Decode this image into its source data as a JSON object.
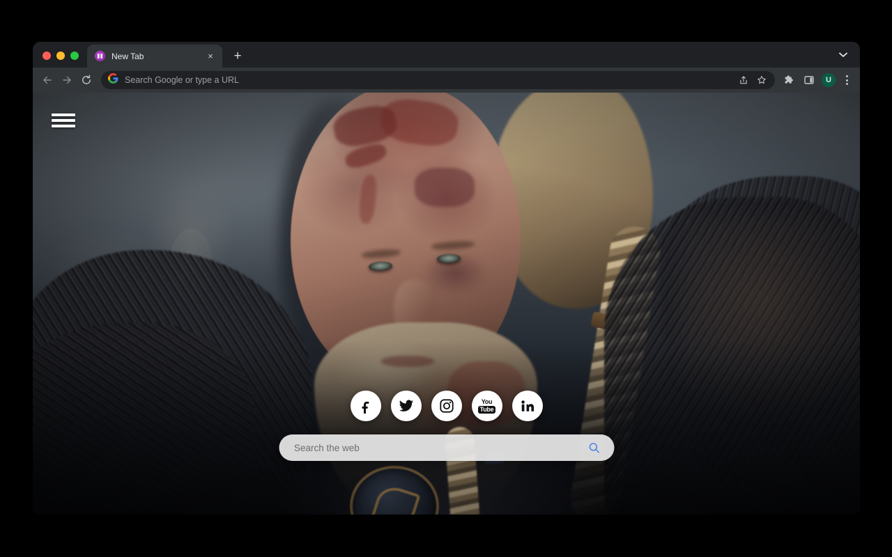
{
  "browser": {
    "window_controls": [
      "close",
      "minimize",
      "maximize"
    ],
    "tab": {
      "title": "New Tab",
      "favicon_name": "wallpaper-extension-favicon",
      "close_label": "×"
    },
    "new_tab_label": "+",
    "tabstrip_chevron_label": "⌄",
    "nav": {
      "back_label": "←",
      "forward_label": "→",
      "reload_label": "⟳"
    },
    "omnibox": {
      "placeholder": "Search Google or type a URL",
      "value": "",
      "site_icon_name": "google-g-icon"
    },
    "toolbar_icons": [
      {
        "name": "share-icon",
        "label": "Share"
      },
      {
        "name": "bookmark-star-icon",
        "label": "Bookmark"
      },
      {
        "name": "extensions-puzzle-icon",
        "label": "Extensions"
      },
      {
        "name": "side-panel-icon",
        "label": "Side panel"
      }
    ],
    "profile": {
      "initial": "U",
      "color": "#0b5c45"
    },
    "menu_label": "Customize and control Google Chrome"
  },
  "newtab": {
    "menu_button": {
      "name": "hamburger-menu",
      "label": "Menu"
    },
    "social_links": [
      {
        "name": "facebook-icon",
        "label": "Facebook"
      },
      {
        "name": "twitter-icon",
        "label": "Twitter"
      },
      {
        "name": "instagram-icon",
        "label": "Instagram"
      },
      {
        "name": "youtube-icon",
        "label": "YouTube",
        "text_top": "You",
        "text_bottom": "Tube"
      },
      {
        "name": "linkedin-icon",
        "label": "LinkedIn",
        "text": "in"
      }
    ],
    "search": {
      "placeholder": "Search the web",
      "value": "",
      "submit_icon_name": "search-icon"
    },
    "background": {
      "description": "Bloodied Viking warrior portrait with braided blond hair and dark fur cloak",
      "accent_color": "#4285f4",
      "pill_color": "#e8e8e8"
    }
  }
}
